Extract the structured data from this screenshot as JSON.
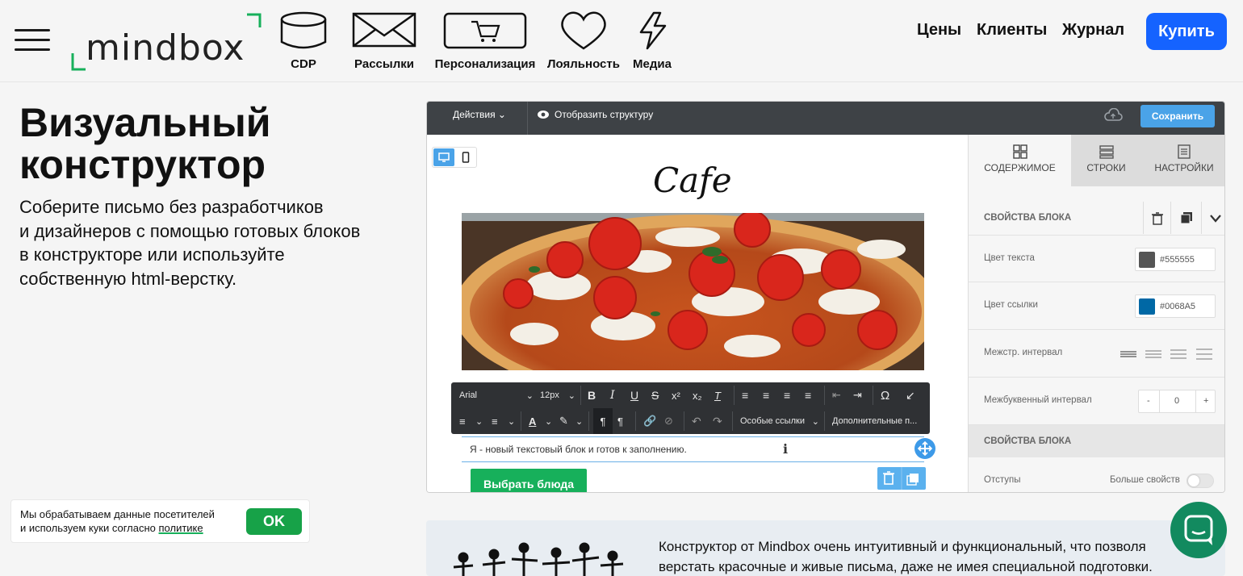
{
  "header": {
    "logo_text": "mindbox",
    "nav": [
      {
        "label": "CDP",
        "icon": "database-icon"
      },
      {
        "label": "Рассылки",
        "icon": "envelope-icon"
      },
      {
        "label": "Персонализация",
        "icon": "cart-icon"
      },
      {
        "label": "Лояльность",
        "icon": "heart-icon"
      },
      {
        "label": "Медиа",
        "icon": "lightning-icon"
      }
    ],
    "links": [
      "Цены",
      "Клиенты",
      "Журнал"
    ],
    "buy_label": "Купить"
  },
  "hero": {
    "title_lines": [
      "Визуальный",
      "конструктор"
    ],
    "subtitle_lines": [
      "Соберите письмо без разработчиков",
      "и дизайнеров с помощью готовых блоков",
      "в конструкторе или используйте",
      "собственную html-верстку."
    ]
  },
  "editor": {
    "actions_label": "Действия",
    "show_structure_label": "Отобразить структуру",
    "save_label": "Сохранить",
    "email_title": "Cafe",
    "toolbar": {
      "font": "Arial",
      "size": "12px",
      "special_links": "Особые ссылки",
      "more": "Дополнительные п..."
    },
    "text_block": "Я - новый текстовый блок и готов к заполнению.",
    "button_label": "Выбрать блюда",
    "panel": {
      "tabs": [
        "СОДЕРЖИМОЕ",
        "СТРОКИ",
        "НАСТРОЙКИ"
      ],
      "section1": "СВОЙСТВА БЛОКА",
      "text_color_label": "Цвет текста",
      "text_color": "#555555",
      "link_color_label": "Цвет ссылки",
      "link_color": "#0068A5",
      "line_height_label": "Межстр. интервал",
      "letter_spacing_label": "Межбуквенный интервал",
      "letter_spacing_value": "0",
      "minus": "-",
      "plus": "+",
      "section2": "СВОЙСТВА БЛОКА",
      "padding_label": "Отступы",
      "more_props_label": "Больше свойств"
    }
  },
  "cookie": {
    "line1": "Мы обрабатываем данные посетителей",
    "line2_prefix": "и используем куки согласно ",
    "line2_link": "политике",
    "ok_label": "OK"
  },
  "testimonial": {
    "line1": "Конструктор от Mindbox очень интуитивный и функциональный, что позволя",
    "line2": "верстать красочные и живые письма, даже не имея специальной подготовки."
  },
  "colors": {
    "accent": "#1563ff",
    "green": "#17a248",
    "chat": "#128a5f",
    "editor_bar": "#3e4246"
  }
}
